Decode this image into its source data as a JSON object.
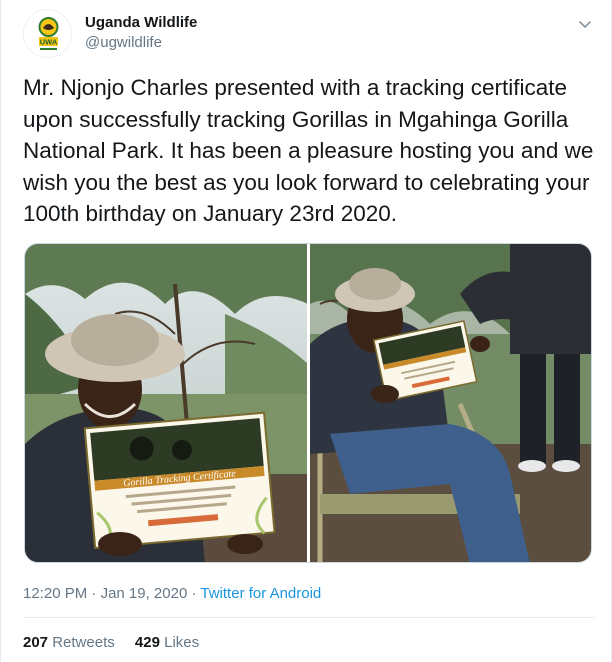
{
  "author": {
    "display_name": "Uganda Wildlife",
    "handle": "@ugwildlife",
    "avatar_logo_text": "UWA",
    "avatar_icon": "uwa-logo-icon"
  },
  "tweet": {
    "text": "Mr. Njonjo Charles presented with a tracking certificate upon successfully tracking Gorillas in Mgahinga Gorilla National Park. It has been a pleasure hosting you and we wish you the best as you look forward to celebrating your 100th birthday on January 23rd 2020.",
    "menu_icon": "chevron-down-icon"
  },
  "media": {
    "photos": [
      {
        "certificate_title": "Gorilla Tracking Certificate"
      },
      {
        "certificate_title": ""
      }
    ]
  },
  "meta": {
    "time": "12:20 PM",
    "separator": "·",
    "date": "Jan 19, 2020",
    "source": "Twitter for Android"
  },
  "stats": {
    "retweets_count": "207",
    "retweets_label": "Retweets",
    "likes_count": "429",
    "likes_label": "Likes"
  },
  "colors": {
    "text": "#14171a",
    "secondary": "#657786",
    "link": "#1b95e0",
    "border": "#e6ecf0"
  }
}
